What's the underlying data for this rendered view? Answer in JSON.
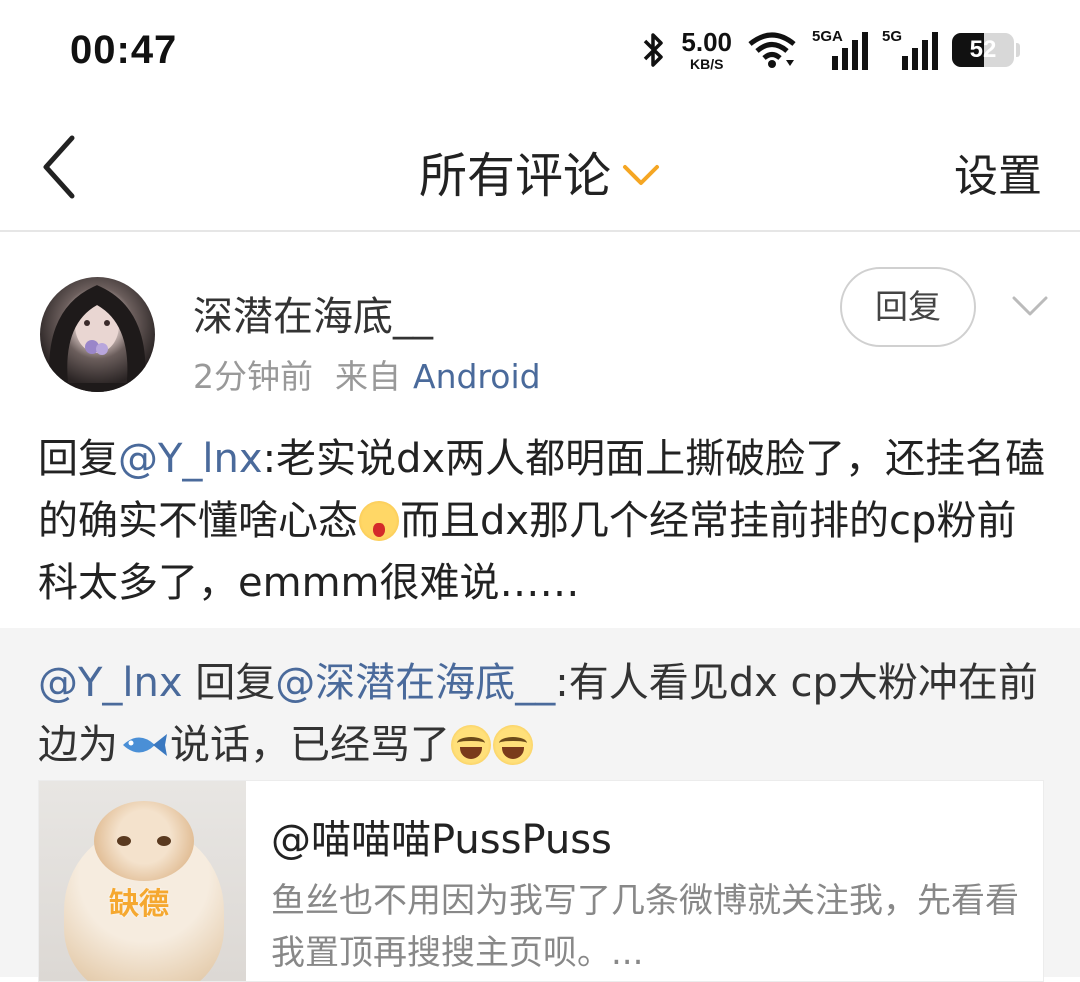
{
  "status_bar": {
    "time": "00:47",
    "net_speed": "5.00",
    "net_unit": "KB/S",
    "sim1_tag": "5GA",
    "sim2_tag": "5G",
    "battery": "52",
    "battery_level": 0.52
  },
  "header": {
    "title": "所有评论",
    "settings_label": "设置"
  },
  "comment": {
    "username": "深潜在海底__",
    "time_ago": "2分钟前",
    "source_prefix": "来自",
    "device": "Android",
    "reply_label": "回复",
    "text": {
      "prefix": "回复",
      "mention": "@Y_lnx",
      "part1": ":老实说dx两人都明面上撕破脸了，还挂名磕的确实不懂啥心态",
      "part2": "而且dx那几个经常挂前排的cp粉前科太多了，emmm很难说……"
    }
  },
  "quote": {
    "author": "@Y_lnx",
    "reply_word": "回复",
    "mention": "@深潜在海底__",
    "part1": ":有人看见dx cp大粉冲在前边为",
    "part2": "说话，已经骂了",
    "card": {
      "title": "@喵喵喵PussPuss",
      "description": "鱼丝也不用因为我写了几条微博就关注我，先看看我置顶再搜搜主页呗。...",
      "image_label": "缺德"
    }
  },
  "colors": {
    "accent_orange": "#f5a623",
    "link_blue": "#4a6a9b",
    "quote_bg": "#f4f4f4"
  }
}
